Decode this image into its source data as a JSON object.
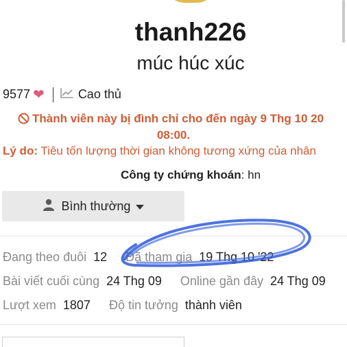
{
  "profile": {
    "username": "thanh226",
    "title": "múc húc xúc",
    "likes": "9577",
    "rank": "Cao thủ"
  },
  "suspension": {
    "line1": "Thành viên này bị đình chỉ cho đến ngày 9 Thg 10 20",
    "line2": "08:00.",
    "reason_label": "Lý do:",
    "reason_text": "Tiêu tốn lượng thời gian không tương xứng của nhân"
  },
  "broker": {
    "label": "Công ty chứng khoán",
    "value": "hn"
  },
  "notification_dropdown": {
    "label": "Bình thường"
  },
  "stats": {
    "following_label": "Đang theo đuôi",
    "following_value": "12",
    "joined_label": "Đã tham gia",
    "joined_value": "19 Thg 10 '22",
    "last_post_label": "Bài viết cuối cùng",
    "last_post_value": "24 Thg 09",
    "online_label": "Online gần đây",
    "online_value": "24 Thg 09",
    "views_label": "Lượt xem",
    "views_value": "1807",
    "trust_label": "Độ tin tưởng",
    "trust_value": "thành viên"
  },
  "colors": {
    "alert": "#cf5c34",
    "heart": "#e05a7a",
    "scribble": "#2f5bd6",
    "muted": "#8a8a8a"
  },
  "icons": [
    "heart-icon",
    "chart-icon",
    "ban-icon",
    "person-icon",
    "caret-down-icon"
  ]
}
